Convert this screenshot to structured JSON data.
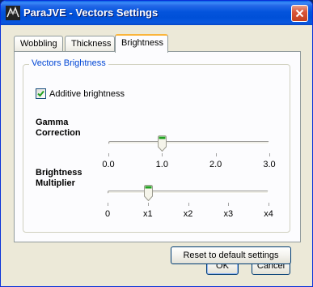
{
  "window": {
    "title": "ParaJVE - Vectors Settings"
  },
  "tabs": [
    {
      "label": "Wobbling"
    },
    {
      "label": "Thickness"
    },
    {
      "label": "Brightness"
    }
  ],
  "group": {
    "title": "Vectors Brightness",
    "additive_label": "Additive brightness",
    "additive_checked": true
  },
  "gamma": {
    "label_line1": "Gamma",
    "label_line2": "Correction",
    "min": 0.0,
    "max": 3.0,
    "value": 1.0,
    "tick_labels": [
      "0.0",
      "1.0",
      "2.0",
      "3.0"
    ]
  },
  "multiplier": {
    "label_line1": "Brightness",
    "label_line2": "Multiplier",
    "min": 0,
    "max": 4,
    "value": 1,
    "tick_labels": [
      "0",
      "x1",
      "x2",
      "x3",
      "x4"
    ]
  },
  "buttons": {
    "reset": "Reset to default settings",
    "ok": "OK",
    "cancel": "Cancel"
  },
  "colors": {
    "title_bar": "#0054e3",
    "group_title": "#0046d5",
    "active_tab_highlight": "#fab53b",
    "thumb_accent": "#21a121"
  }
}
